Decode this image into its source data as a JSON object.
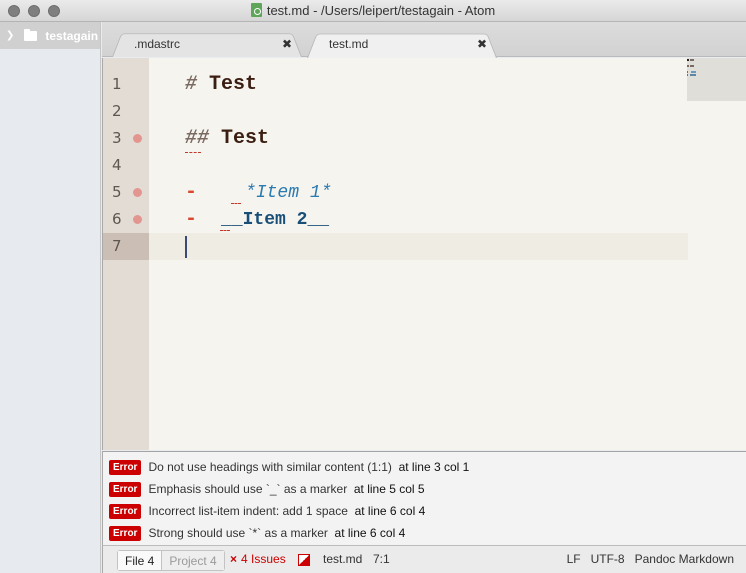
{
  "window": {
    "title": "test.md - /Users/leipert/testagain - Atom",
    "title_icon": "markdown-file-icon"
  },
  "sidebar": {
    "root": {
      "label": "testagain",
      "expanded": false
    }
  },
  "tabs": [
    {
      "label": ".mdastrc",
      "active": false,
      "close": "×"
    },
    {
      "label": "test.md",
      "active": true,
      "close": "×"
    }
  ],
  "editor": {
    "lines": [
      {
        "num": "1",
        "marker": false
      },
      {
        "num": "2",
        "marker": false
      },
      {
        "num": "3",
        "marker": true
      },
      {
        "num": "4",
        "marker": false
      },
      {
        "num": "5",
        "marker": true
      },
      {
        "num": "6",
        "marker": true
      },
      {
        "num": "7",
        "marker": false,
        "current": true
      }
    ],
    "code": {
      "l1_hash": "#",
      "l1_text": " Test",
      "l3_hash": "##",
      "l3_text": " Test",
      "l5_dash": "-",
      "l5_text": "*Item 1*",
      "l6_dash": "-",
      "l6_text": "__Item 2__"
    }
  },
  "linter": {
    "badge_label": "Error",
    "issues": [
      {
        "message": "Do not use headings with similar content (1:1)",
        "location": "at line 3 col 1"
      },
      {
        "message": "Emphasis should use `_` as a marker",
        "location": "at line 5 col 5"
      },
      {
        "message": "Incorrect list-item indent: add 1 space",
        "location": "at line 6 col 4"
      },
      {
        "message": "Strong should use `*` as a marker",
        "location": "at line 6 col 4"
      }
    ]
  },
  "statusbar": {
    "file_scope": "File 4",
    "project_scope": "Project 4",
    "issues_icon": "×",
    "issues_label": "4 Issues",
    "filename": "test.md",
    "cursor_position": "7:1",
    "line_ending": "LF",
    "encoding": "UTF-8",
    "grammar": "Pandoc Markdown"
  },
  "colors": {
    "error": "#cc0000",
    "gutter_marker": "#e39590",
    "emphasis": "#2b7ab0",
    "strong": "#194f77"
  }
}
